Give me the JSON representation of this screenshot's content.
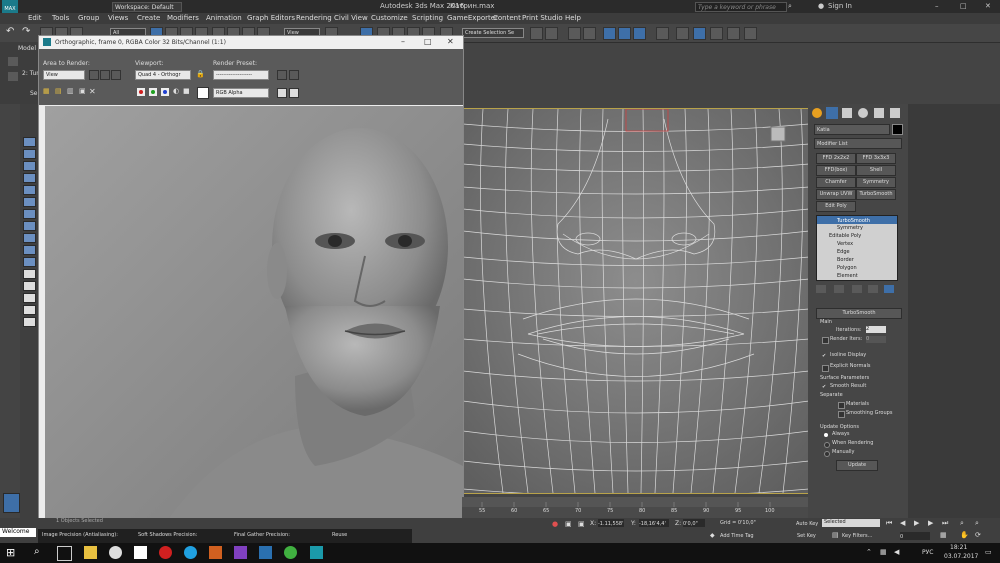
{
  "title_bar": {
    "workspace": "Workspace: Default",
    "app_title": "Autodesk 3ds Max 2016",
    "file_name": "Катрин.max",
    "search_placeholder": "Type a keyword or phrase",
    "sign_in": "Sign In"
  },
  "menu": [
    "Edit",
    "Tools",
    "Group",
    "Views",
    "Create",
    "Modifiers",
    "Animation",
    "Graph Editors",
    "Rendering",
    "Civil View",
    "Customize",
    "Scripting",
    "GameExporter",
    "Content",
    "Print Studio",
    "Help"
  ],
  "toolbar": {
    "filter": "All",
    "view": "View",
    "selection_set": "Create Selection Se"
  },
  "ribbon": {
    "model_tab": "Model",
    "label2": "2: Tur",
    "label_sel": "Sel"
  },
  "render_window": {
    "title": "Orthographic, frame 0, RGBA Color 32 Bits/Channel (1:1)",
    "area_label": "Area to Render:",
    "area_value": "View",
    "viewport_label": "Viewport:",
    "viewport_value": "Quad 4 - Orthogr",
    "preset_label": "Render Preset:",
    "preset_value": "--------------------",
    "channel_value": "RGB Alpha"
  },
  "command_panel": {
    "object_name": "Katia",
    "modifier_list": "Modifier List",
    "buttons": [
      "FFD 2x2x2",
      "FFD 3x3x3",
      "FFD(box)",
      "Shell",
      "Chamfer",
      "Symmetry",
      "Unwrap UVW",
      "TurboSmooth",
      "Edit Poly"
    ],
    "stack": [
      "TurboSmooth",
      "Symmetry",
      "Editable Poly",
      "Vertex",
      "Edge",
      "Border",
      "Polygon",
      "Element"
    ],
    "rollout_title": "TurboSmooth",
    "main_label": "Main",
    "iterations_label": "Iterations:",
    "iterations_value": "2",
    "render_iters_label": "Render Iters:",
    "render_iters_value": "0",
    "isoline": "Isoline Display",
    "explicit_normals": "Explicit Normals",
    "surface_params": "Surface Parameters",
    "smooth_result": "Smooth Result",
    "separate": "Separate",
    "materials": "Materials",
    "smoothing_groups": "Smoothing Groups",
    "update_options": "Update Options",
    "always": "Always",
    "when_rendering": "When Rendering",
    "manually": "Manually",
    "update_button": "Update"
  },
  "timeline": {
    "ticks": [
      "55",
      "60",
      "65",
      "70",
      "75",
      "80",
      "85",
      "90",
      "95",
      "100"
    ]
  },
  "status": {
    "x_label": "X:",
    "x_value": "-1.11,558'",
    "y_label": "Y:",
    "y_value": "-18,16'4,4'",
    "z_label": "Z:",
    "z_value": "0'0,0\"",
    "grid": "Grid = 0'10,0\"",
    "add_time_tag": "Add Time Tag",
    "auto_key": "Auto Key",
    "selected": "Selected",
    "set_key": "Set Key",
    "key_filters": "Key Filters...",
    "frame": "0",
    "welcome": "Welcome",
    "image_precision": "Image Precision (Antialiasing):",
    "soft_shadow": "Soft Shadows Precision:",
    "final_gather": "Final Gather Precision:",
    "reuse": "Reuse",
    "selected_hint": "1 Objects Selected"
  },
  "taskbar": {
    "lang": "РУС",
    "time": "18:21",
    "date": "03.07.2017"
  },
  "colors": {
    "accent": "#3e6fa8",
    "viewport_border": "#b8a24a"
  }
}
